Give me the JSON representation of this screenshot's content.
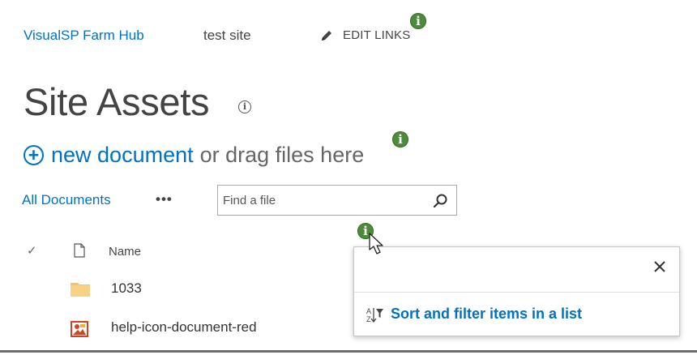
{
  "nav": {
    "hub_label": "VisualSP Farm Hub",
    "site_label": "test site",
    "edit_links_label": "EDIT LINKS"
  },
  "help_marker_glyph": "i",
  "page": {
    "title": "Site Assets"
  },
  "new_document": {
    "link_label": "new document",
    "suffix_text": "or drag files here"
  },
  "view": {
    "all_documents_label": "All Documents",
    "more_label": "•••"
  },
  "search": {
    "placeholder": "Find a file"
  },
  "list": {
    "check_glyph": "✓",
    "name_header": "Name",
    "rows": [
      {
        "name": "1033",
        "type": "folder"
      },
      {
        "name": "help-icon-document-red",
        "type": "image"
      }
    ]
  },
  "callout": {
    "close_glyph": "✕",
    "link_label": "Sort and filter items in a list"
  },
  "colors": {
    "link": "#0072c6",
    "help_marker": "#4e8a3c",
    "folder": "#f2c46e",
    "image_icon": "#d04423"
  }
}
